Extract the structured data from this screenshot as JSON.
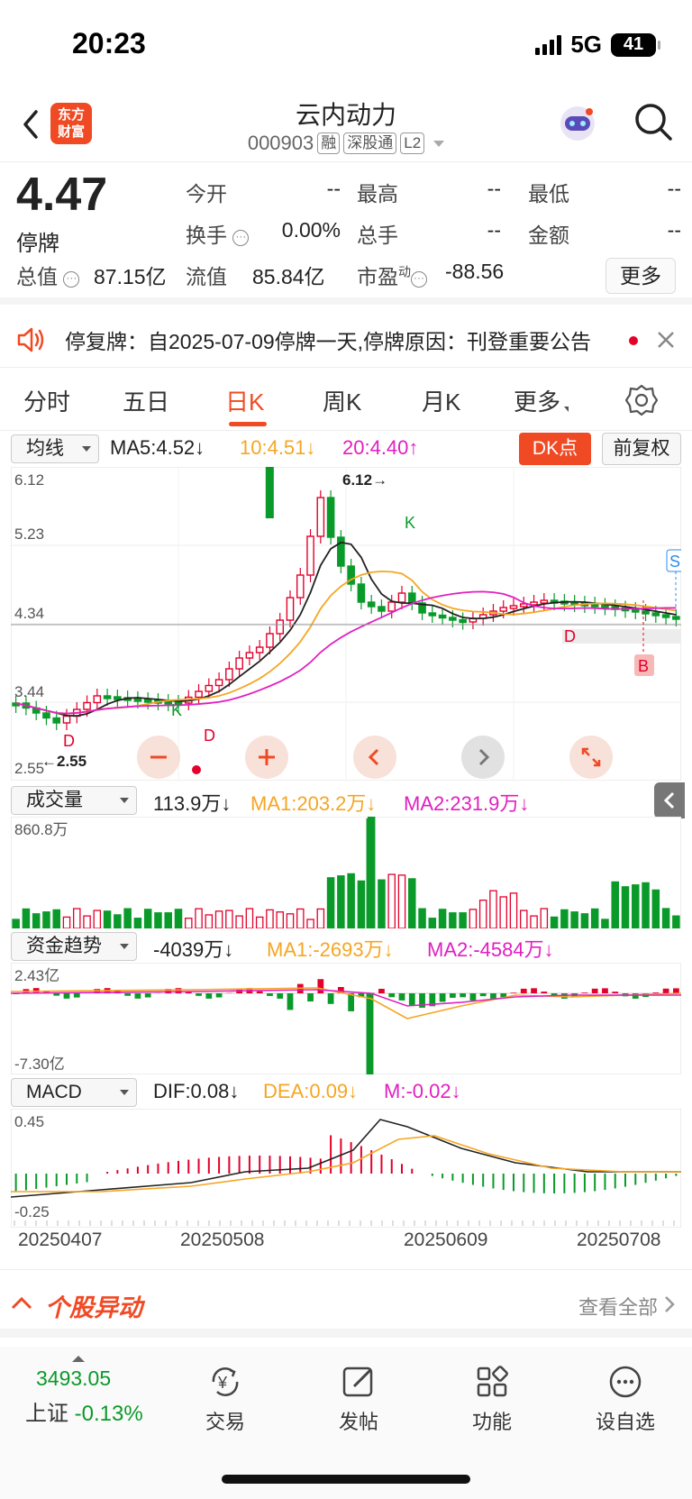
{
  "status_bar": {
    "time": "20:23",
    "network": "5G",
    "battery": "41"
  },
  "header": {
    "logo_line1": "东方",
    "logo_line2": "财富",
    "name": "云内动力",
    "code": "000903",
    "tags": [
      "融",
      "深股通",
      "L2"
    ]
  },
  "quote": {
    "price": "4.47",
    "status": "停牌",
    "rows": [
      [
        {
          "label": "今开",
          "value": "--"
        },
        {
          "label": "最高",
          "value": "--"
        },
        {
          "label": "最低",
          "value": "--"
        }
      ],
      [
        {
          "label": "换手",
          "value": "0.00%"
        },
        {
          "label": "总手",
          "value": "--"
        },
        {
          "label": "金额",
          "value": "--"
        }
      ]
    ],
    "total_cap_label": "总值",
    "total_cap": "87.15亿",
    "float_cap_label": "流值",
    "float_cap": "85.84亿",
    "pe_label": "市盈",
    "pe_sup": "动",
    "pe": "-88.56",
    "more": "更多"
  },
  "notice": {
    "text": "停复牌：自2025-07-09停牌一天,停牌原因：刊登重要公告"
  },
  "tabs": [
    "分时",
    "五日",
    "日K",
    "周K",
    "月K",
    "更多"
  ],
  "main_indicator": {
    "selector": "均线",
    "ma5": "MA5:4.52↓",
    "ma10": "10:4.51↓",
    "ma20": "20:4.40↑",
    "dk": "DK点",
    "adjust": "前复权"
  },
  "kline": {
    "y_top": "6.12",
    "y_2": "5.23",
    "y_3": "4.34",
    "y_4": "3.44",
    "y_bottom": "2.55",
    "high_mark": "6.12→",
    "low_mark": "←2.55",
    "marks": {
      "k": "K",
      "d": "D",
      "s": "S",
      "b": "B"
    }
  },
  "volume": {
    "selector": "成交量",
    "value": "113.9万↓",
    "ma1": "MA1:203.2万↓",
    "ma2": "MA2:231.9万↓",
    "y_top": "860.8万"
  },
  "fund": {
    "selector": "资金趋势",
    "value": "-4039万↓",
    "ma1": "MA1:-2693万↓",
    "ma2": "MA2:-4584万↓",
    "y_top": "2.43亿",
    "y_bottom": "-7.30亿"
  },
  "macd": {
    "selector": "MACD",
    "dif": "DIF:0.08↓",
    "dea": "DEA:0.09↓",
    "m": "M:-0.02↓",
    "y_top": "0.45",
    "y_bottom": "-0.25"
  },
  "dates": [
    "20250407",
    "20250508",
    "20250609",
    "20250708"
  ],
  "movers": {
    "title": "个股异动",
    "view_all": "查看全部"
  },
  "bottom_nav": {
    "index_value": "3493.05",
    "index_name": "上证",
    "index_change": "-0.13%",
    "items": [
      "交易",
      "发帖",
      "功能",
      "设自选"
    ]
  },
  "colors": {
    "up": "#e3002b",
    "down": "#0a9a2a",
    "accent": "#f04a24",
    "ma5": "#222222",
    "ma10": "#f5a623",
    "ma20": "#e020c0"
  }
}
